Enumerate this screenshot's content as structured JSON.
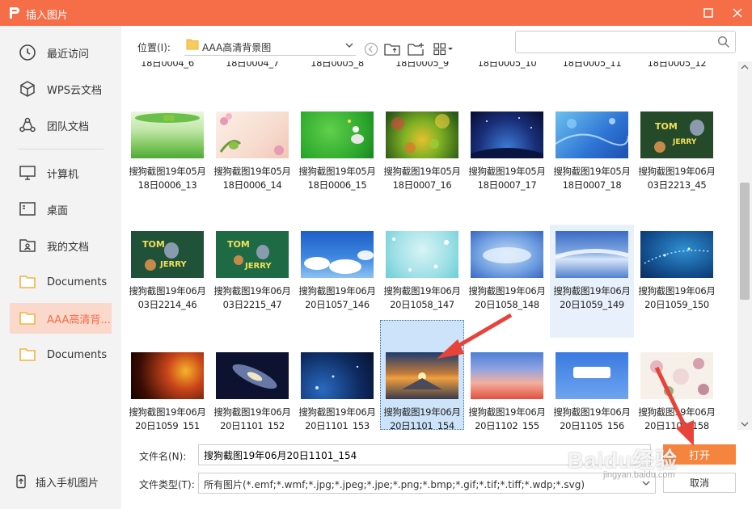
{
  "window": {
    "title": "插入图片"
  },
  "sidebar": {
    "items": [
      {
        "label": "最近访问",
        "icon": "clock-icon"
      },
      {
        "label": "WPS云文档",
        "icon": "cube-icon"
      },
      {
        "label": "团队文档",
        "icon": "team-icon"
      },
      {
        "label": "计算机",
        "icon": "monitor-icon"
      },
      {
        "label": "桌面",
        "icon": "desktop-icon"
      },
      {
        "label": "我的文档",
        "icon": "user-folder-icon"
      },
      {
        "label": "Documents",
        "icon": "folder-icon"
      },
      {
        "label": "AAA高清背...",
        "icon": "folder-icon",
        "active": true
      },
      {
        "label": "Documents",
        "icon": "folder-icon"
      }
    ],
    "mobile_label": "插入手机图片"
  },
  "toolbar": {
    "location_label": "位置(I):",
    "location_value": "AAA高清背景图",
    "search_placeholder": ""
  },
  "grid": {
    "cut_row": [
      "18日0004_6",
      "18日0004_7",
      "18日0005_8",
      "18日0005_9",
      "18日0005_10",
      "18日0005_11",
      "18日0005_12"
    ],
    "rows": [
      [
        {
          "line1": "搜狗截图19年05月",
          "line2": "18日0006_13"
        },
        {
          "line1": "搜狗截图19年05月",
          "line2": "18日0006_14"
        },
        {
          "line1": "搜狗截图19年05月",
          "line2": "18日0006_15"
        },
        {
          "line1": "搜狗截图19年05月",
          "line2": "18日0007_16"
        },
        {
          "line1": "搜狗截图19年05月",
          "line2": "18日0007_17"
        },
        {
          "line1": "搜狗截图19年05月",
          "line2": "18日0007_18"
        },
        {
          "line1": "搜狗截图19年06月",
          "line2": "03日2213_45"
        }
      ],
      [
        {
          "line1": "搜狗截图19年06月",
          "line2": "03日2214_46"
        },
        {
          "line1": "搜狗截图19年06月",
          "line2": "03日2215_47"
        },
        {
          "line1": "搜狗截图19年06月",
          "line2": "20日1057_146"
        },
        {
          "line1": "搜狗截图19年06月",
          "line2": "20日1058_147"
        },
        {
          "line1": "搜狗截图19年06月",
          "line2": "20日1058_148"
        },
        {
          "line1": "搜狗截图19年06月",
          "line2": "20日1059_149"
        },
        {
          "line1": "搜狗截图19年06月",
          "line2": "20日1059_150"
        }
      ],
      [
        {
          "line1": "搜狗截图19年06月",
          "line2": "20日1059_151"
        },
        {
          "line1": "搜狗截图19年06月",
          "line2": "20日1101_152"
        },
        {
          "line1": "搜狗截图19年06月",
          "line2": "20日1101_153"
        },
        {
          "line1": "搜狗截图19年06月",
          "line2": "20日1101_154"
        },
        {
          "line1": "搜狗截图19年06月",
          "line2": "20日1102_155"
        },
        {
          "line1": "搜狗截图19年06月",
          "line2": "20日1105_156"
        },
        {
          "line1": "搜狗截图19年06月",
          "line2": "20日1109_158"
        }
      ]
    ]
  },
  "bottom": {
    "filename_label": "文件名(N):",
    "filename_value": "搜狗截图19年06月20日1101_154",
    "filetype_label": "文件类型(T):",
    "filetype_value": "所有图片(*.emf;*.wmf;*.jpg;*.jpeg;*.jpe;*.png;*.bmp;*.gif;*.tif;*.tiff;*.wdp;*.svg)",
    "open_label": "打开",
    "cancel_label": "取消"
  },
  "watermark": {
    "main": "Baidu经验",
    "sub": "jingyan.baidu.com"
  },
  "colors": {
    "accent": "#f56e47",
    "selection": "#cce3f9",
    "annotation": "#e8433a"
  }
}
